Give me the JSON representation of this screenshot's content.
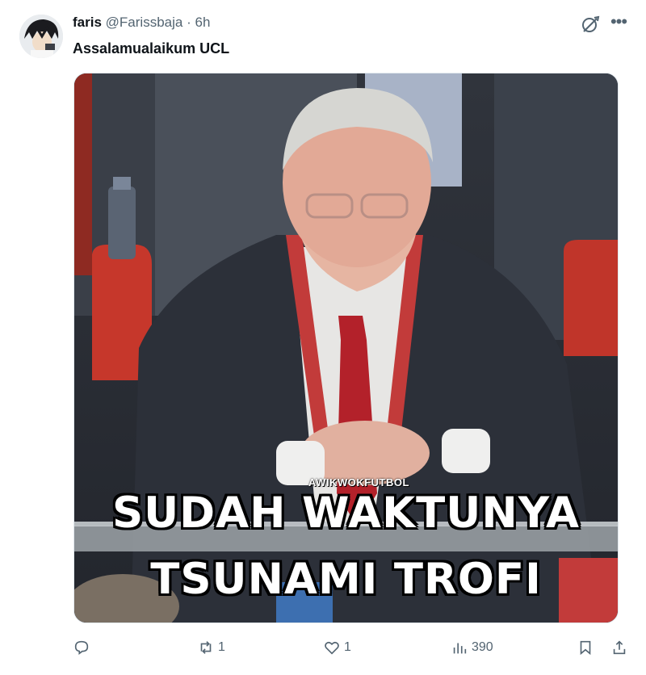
{
  "author": {
    "name": "faris",
    "handle": "@Farissbaja",
    "separator": "·",
    "time": "6h"
  },
  "post": {
    "text": "Assalamualaikum UCL"
  },
  "media": {
    "watermark": "AWIKWOKFUTBOL",
    "caption_line1": "SUDAH WAKTUNYA",
    "caption_line2": "TSUNAMI TROFI"
  },
  "actions": {
    "replies": "",
    "reposts": "1",
    "likes": "1",
    "views": "390"
  },
  "icons": {
    "reply": "reply-icon",
    "repost": "repost-icon",
    "like": "heart-icon",
    "views": "views-icon",
    "bookmark": "bookmark-icon",
    "share": "share-icon",
    "grok": "grok-icon",
    "more": "more-icon"
  }
}
